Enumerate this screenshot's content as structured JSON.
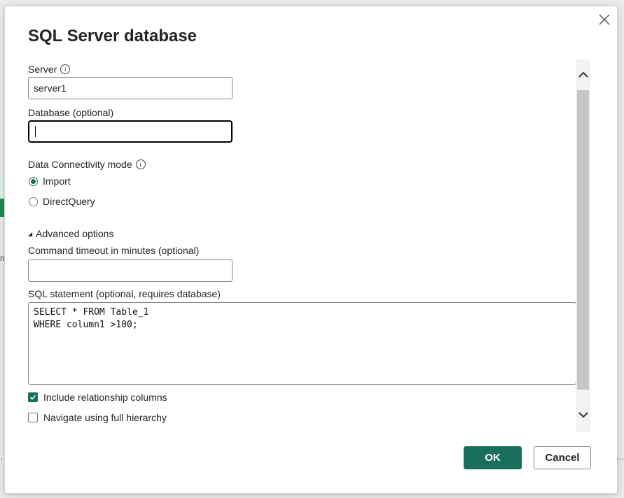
{
  "background": {
    "fragment_m": "m",
    "fragment_dots_left": ".",
    "fragment_dots_right": "..."
  },
  "dialog": {
    "title": "SQL Server database",
    "close_icon": "close-icon",
    "server": {
      "label": "Server",
      "value": "server1",
      "info_icon": "info-icon"
    },
    "database": {
      "label": "Database (optional)",
      "value": ""
    },
    "connectivity": {
      "label": "Data Connectivity mode",
      "options": [
        {
          "label": "Import",
          "selected": true
        },
        {
          "label": "DirectQuery",
          "selected": false
        }
      ]
    },
    "advanced": {
      "toggle_label": "Advanced options",
      "expanded": true,
      "timeout": {
        "label": "Command timeout in minutes (optional)",
        "value": ""
      },
      "sql": {
        "label": "SQL statement (optional, requires database)",
        "value": "SELECT * FROM Table_1\nWHERE column1 >100;"
      },
      "checkboxes": [
        {
          "label": "Include relationship columns",
          "checked": true
        },
        {
          "label": "Navigate using full hierarchy",
          "checked": false
        }
      ]
    },
    "buttons": {
      "ok": "OK",
      "cancel": "Cancel"
    },
    "colors": {
      "accent": "#1a6e5c",
      "border": "#8a8886",
      "text": "#252423"
    }
  }
}
